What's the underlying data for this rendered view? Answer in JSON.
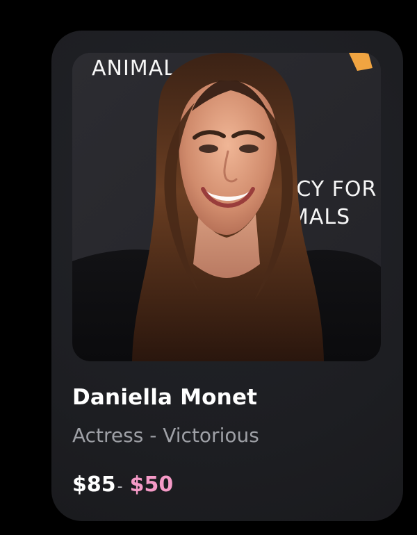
{
  "card": {
    "name": "Daniella Monet",
    "subtitle": "Actress - Victorious",
    "price": {
      "original": "$85",
      "separator": "-",
      "sale": "$50"
    },
    "photo": {
      "backdrop_text_top": "ANIMAL",
      "backdrop_text_line2": "RCY FOR",
      "backdrop_text_line3": "MALS"
    }
  },
  "colors": {
    "page_background": "#000000",
    "card_background": "#1d1e22",
    "name": "#ffffff",
    "subtitle": "#9ea0a6",
    "price_original": "#ffffff",
    "price_sale": "#f59ac7"
  }
}
